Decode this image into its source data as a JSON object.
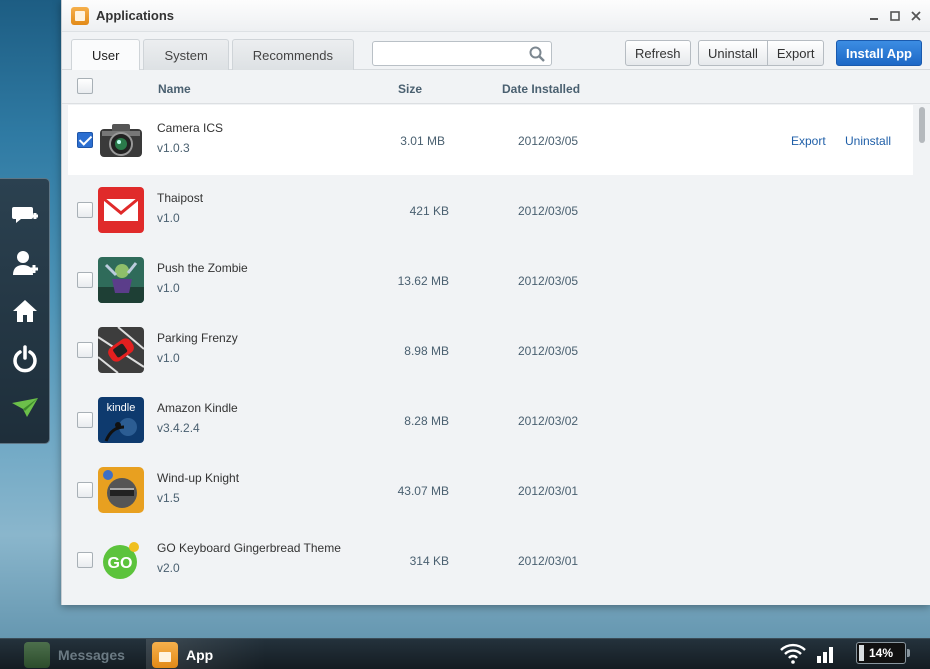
{
  "window": {
    "title": "Applications"
  },
  "tabs": [
    {
      "label": "User",
      "active": true
    },
    {
      "label": "System",
      "active": false
    },
    {
      "label": "Recommends",
      "active": false
    }
  ],
  "search": {
    "placeholder": "",
    "value": ""
  },
  "toolbar": {
    "refresh_label": "Refresh",
    "uninstall_label": "Uninstall",
    "export_label": "Export",
    "install_label": "Install App"
  },
  "columns": {
    "name": "Name",
    "size": "Size",
    "date": "Date Installed"
  },
  "apps": [
    {
      "name": "Camera ICS",
      "version": "v1.0.3",
      "size": "3.01 MB",
      "date": "2012/03/05",
      "checked": true,
      "icon": "camera-icon",
      "export_label": "Export",
      "uninstall_label": "Uninstall"
    },
    {
      "name": "Thaipost",
      "version": "v1.0",
      "size": "421 KB",
      "date": "2012/03/05",
      "checked": false,
      "icon": "mail-envelope-icon"
    },
    {
      "name": "Push the Zombie",
      "version": "v1.0",
      "size": "13.62 MB",
      "date": "2012/03/05",
      "checked": false,
      "icon": "zombie-game-icon"
    },
    {
      "name": "Parking Frenzy",
      "version": "v1.0",
      "size": "8.98 MB",
      "date": "2012/03/05",
      "checked": false,
      "icon": "red-car-icon"
    },
    {
      "name": "Amazon Kindle",
      "version": "v3.4.2.4",
      "size": "8.28 MB",
      "date": "2012/03/02",
      "checked": false,
      "icon": "kindle-icon",
      "icon_text": "kindle"
    },
    {
      "name": "Wind-up Knight",
      "version": "v1.5",
      "size": "43.07 MB",
      "date": "2012/03/01",
      "checked": false,
      "icon": "knight-helmet-icon"
    },
    {
      "name": "GO Keyboard Gingerbread Theme",
      "version": "v2.0",
      "size": "314 KB",
      "date": "2012/03/01",
      "checked": false,
      "icon": "go-keyboard-icon",
      "icon_text": "GO"
    }
  ],
  "dock": [
    "add-message-icon",
    "add-contact-icon",
    "home-icon",
    "power-icon",
    "paper-plane-icon"
  ],
  "taskbar": {
    "messages_label": "Messages",
    "app_label": "App",
    "battery": "14%"
  },
  "colors": {
    "accent": "#1d68c6",
    "link": "#1f5fa8",
    "header_text": "#4a6070"
  }
}
